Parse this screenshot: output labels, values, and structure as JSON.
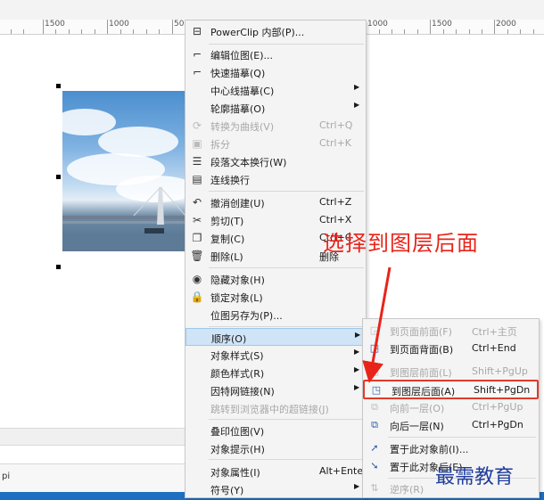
{
  "ruler": {
    "left_ticks": [
      "1500",
      "1000",
      "50"
    ],
    "right_ticks": [
      "1000",
      "1500",
      "2000"
    ]
  },
  "status": {
    "left_fragment": "pi"
  },
  "context_menu": {
    "items": [
      {
        "icon": "powerclip-icon",
        "label": "PowerClip 内部(P)...",
        "shortcut": "",
        "arrow": false,
        "disabled": false
      },
      {
        "icon": "edit-bitmap-icon",
        "label": "编辑位图(E)...",
        "shortcut": "",
        "arrow": false,
        "disabled": false
      },
      {
        "icon": "quick-trace-icon",
        "label": "快速描摹(Q)",
        "shortcut": "",
        "arrow": false,
        "disabled": false
      },
      {
        "icon": "",
        "label": "中心线描摹(C)",
        "shortcut": "",
        "arrow": true,
        "disabled": false
      },
      {
        "icon": "",
        "label": "轮廓描摹(O)",
        "shortcut": "",
        "arrow": true,
        "disabled": false
      },
      {
        "icon": "convert-curves-icon",
        "label": "转换为曲线(V)",
        "shortcut": "Ctrl+Q",
        "arrow": false,
        "disabled": true
      },
      {
        "icon": "break-apart-icon",
        "label": "拆分",
        "shortcut": "Ctrl+K",
        "arrow": false,
        "disabled": true
      },
      {
        "icon": "wrap-text-icon",
        "label": "段落文本换行(W)",
        "shortcut": "",
        "arrow": false,
        "disabled": false
      },
      {
        "icon": "connector-wrap-icon",
        "label": "连线换行",
        "shortcut": "",
        "arrow": false,
        "disabled": false
      },
      {
        "icon": "undo-icon",
        "label": "撤消创建(U)",
        "shortcut": "Ctrl+Z",
        "arrow": false,
        "disabled": false
      },
      {
        "icon": "cut-icon",
        "label": "剪切(T)",
        "shortcut": "Ctrl+X",
        "arrow": false,
        "disabled": false
      },
      {
        "icon": "copy-icon",
        "label": "复制(C)",
        "shortcut": "Ctrl+C",
        "arrow": false,
        "disabled": false
      },
      {
        "icon": "trash-icon",
        "label": "删除(L)",
        "shortcut": "删除",
        "arrow": false,
        "disabled": false
      },
      {
        "icon": "hide-eye-icon",
        "label": "隐藏对象(H)",
        "shortcut": "",
        "arrow": false,
        "disabled": false
      },
      {
        "icon": "lock-icon",
        "label": "锁定对象(L)",
        "shortcut": "",
        "arrow": false,
        "disabled": false
      },
      {
        "icon": "",
        "label": "位图另存为(P)...",
        "shortcut": "",
        "arrow": false,
        "disabled": false
      },
      {
        "icon": "",
        "label": "顺序(O)",
        "shortcut": "",
        "arrow": true,
        "disabled": false,
        "selected": true
      },
      {
        "icon": "",
        "label": "对象样式(S)",
        "shortcut": "",
        "arrow": true,
        "disabled": false
      },
      {
        "icon": "",
        "label": "颜色样式(R)",
        "shortcut": "",
        "arrow": true,
        "disabled": false
      },
      {
        "icon": "",
        "label": "因特网链接(N)",
        "shortcut": "",
        "arrow": true,
        "disabled": false
      },
      {
        "icon": "",
        "label": "跳转到浏览器中的超链接(J)",
        "shortcut": "",
        "arrow": false,
        "disabled": true
      },
      {
        "icon": "",
        "label": "叠印位图(V)",
        "shortcut": "",
        "arrow": false,
        "disabled": false
      },
      {
        "icon": "",
        "label": "对象提示(H)",
        "shortcut": "",
        "arrow": false,
        "disabled": false
      },
      {
        "icon": "",
        "label": "对象属性(I)",
        "shortcut": "Alt+Enter",
        "arrow": false,
        "disabled": false
      },
      {
        "icon": "",
        "label": "符号(Y)",
        "shortcut": "",
        "arrow": true,
        "disabled": false
      }
    ]
  },
  "order_submenu": {
    "items": [
      {
        "icon": "to-page-front-icon",
        "label": "到页面前面(F)",
        "shortcut": "Ctrl+主页",
        "disabled": true
      },
      {
        "icon": "to-page-back-icon",
        "label": "到页面背面(B)",
        "shortcut": "Ctrl+End",
        "disabled": false
      },
      {
        "icon": "to-layer-front-icon",
        "label": "到图层前面(L)",
        "shortcut": "Shift+PgUp",
        "disabled": true
      },
      {
        "icon": "to-layer-back-icon",
        "label": "到图层后面(A)",
        "shortcut": "Shift+PgDn",
        "disabled": false,
        "highlight": true
      },
      {
        "icon": "forward-one-icon",
        "label": "向前一层(O)",
        "shortcut": "Ctrl+PgUp",
        "disabled": true
      },
      {
        "icon": "back-one-icon",
        "label": "向后一层(N)",
        "shortcut": "Ctrl+PgDn",
        "disabled": false
      },
      {
        "icon": "in-front-of-icon",
        "label": "置于此对象前(I)...",
        "shortcut": "",
        "disabled": false
      },
      {
        "icon": "behind-icon",
        "label": "置于此对象后(E)...",
        "shortcut": "",
        "disabled": false
      },
      {
        "icon": "reverse-order-icon",
        "label": "逆序(R)",
        "shortcut": "",
        "disabled": true
      }
    ]
  },
  "annotation": "选择到图层后面",
  "watermark": "最需教育",
  "colors": {
    "annotation": "#e8241a",
    "highlight_border": "#e03a2a",
    "watermark": "#1f3d9e"
  }
}
